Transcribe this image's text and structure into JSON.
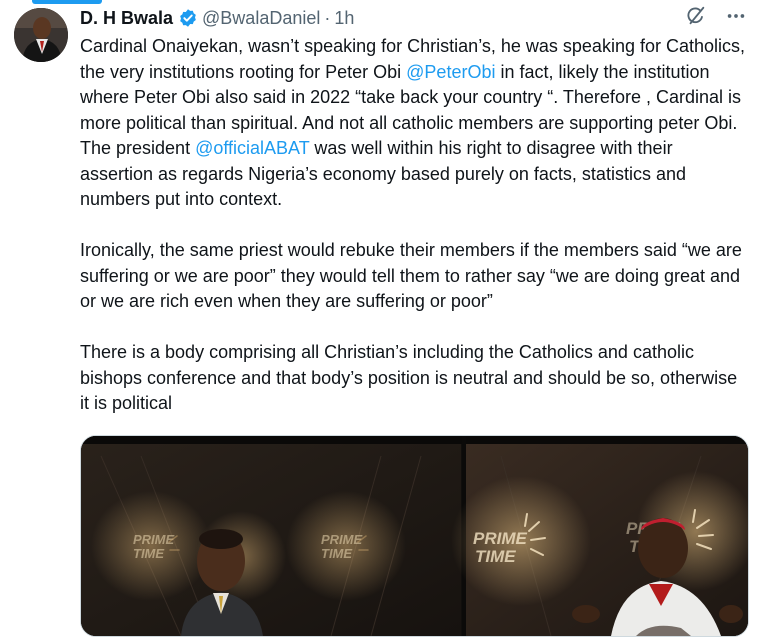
{
  "tweet": {
    "author_name": "D. H Bwala",
    "handle": "@BwalaDaniel",
    "separator": "·",
    "time": "1h",
    "paragraphs": [
      [
        {
          "t": "Cardinal Onaiyekan, wasn’t speaking for Christian’s, he was speaking for Catholics, the very institutions rooting for Peter Obi "
        },
        {
          "t": "@PeterObi",
          "m": true
        },
        {
          "t": "  in fact, likely the institution where Peter Obi also said in 2022 “take back your country “. Therefore , Cardinal is more political than spiritual. And not all catholic members are supporting peter Obi. The president "
        },
        {
          "t": "@officialABAT",
          "m": true
        },
        {
          "t": " was well within his right to disagree with their assertion as regards Nigeria’s economy based purely on facts, statistics and numbers put into context."
        }
      ],
      [
        {
          "t": "Ironically, the same priest would rebuke their members if the members said “we are suffering or we are poor” they would tell them to rather say “we are doing great and or we are rich even when they are suffering or poor”"
        }
      ],
      [
        {
          "t": "There is a body comprising all Christian’s including the Catholics and catholic bishops conference and that body’s position is neutral and should be so, otherwise it is political"
        }
      ]
    ],
    "media": {
      "logo_line1": "PRIME",
      "logo_line2": "TIME"
    },
    "icons": {
      "verified": "verified-badge-icon",
      "grok": "grok-icon",
      "more": "more-icon"
    },
    "colors": {
      "accent": "#1d9bf0",
      "text": "#0f1419",
      "secondary": "#536471"
    }
  }
}
